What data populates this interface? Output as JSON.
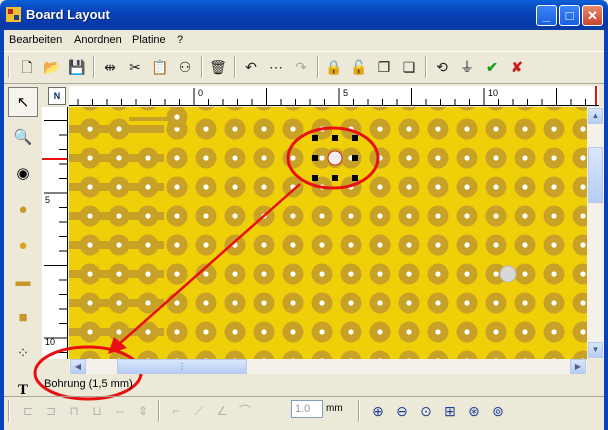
{
  "window": {
    "title": "Board Layout",
    "minimize": "_",
    "maximize": "□",
    "close": "✕"
  },
  "menu": [
    "Bearbeiten",
    "Anordnen",
    "Platine",
    "?"
  ],
  "toolbar": [
    {
      "name": "new-file-icon",
      "glyph": "🗋",
      "enabled": true
    },
    {
      "name": "open-folder-icon",
      "glyph": "📂",
      "enabled": true
    },
    {
      "name": "save-icon",
      "glyph": "💾",
      "enabled": true
    },
    {
      "sep": true
    },
    {
      "name": "mirror-icon",
      "glyph": "⇹",
      "enabled": true
    },
    {
      "name": "cut-icon",
      "glyph": "✂",
      "enabled": true
    },
    {
      "name": "paste-icon",
      "glyph": "📋",
      "enabled": false
    },
    {
      "name": "components-icon",
      "glyph": "⚇",
      "enabled": true
    },
    {
      "sep": true
    },
    {
      "name": "delete-icon",
      "glyph": "🗑",
      "enabled": true
    },
    {
      "sep": true
    },
    {
      "name": "undo-icon",
      "glyph": "↶",
      "enabled": true
    },
    {
      "name": "more-icon",
      "glyph": "⋯",
      "enabled": true
    },
    {
      "name": "redo-icon",
      "glyph": "↷",
      "enabled": false
    },
    {
      "sep": true
    },
    {
      "name": "lock-icon",
      "glyph": "🔒",
      "enabled": false
    },
    {
      "name": "unlock-icon",
      "glyph": "🔓",
      "enabled": false
    },
    {
      "name": "bring-front-icon",
      "glyph": "❐",
      "enabled": true
    },
    {
      "name": "send-back-icon",
      "glyph": "❏",
      "enabled": true
    },
    {
      "sep": true
    },
    {
      "name": "rotate-icon",
      "glyph": "⟲",
      "enabled": true
    },
    {
      "name": "connect-icon",
      "glyph": "⏚",
      "enabled": true
    },
    {
      "name": "ok-check-icon",
      "glyph": "✔",
      "enabled": true,
      "color": "#1e9e1e"
    },
    {
      "name": "cancel-x-icon",
      "glyph": "✘",
      "enabled": true,
      "color": "#c81e1e"
    }
  ],
  "tools": [
    {
      "name": "pointer-tool-icon",
      "glyph": "↖"
    },
    {
      "name": "zoom-tool-icon",
      "glyph": "🔍"
    },
    {
      "name": "pad-tool-icon",
      "glyph": "◉"
    },
    {
      "name": "via-tool-icon",
      "glyph": "●",
      "color": "#c8962a"
    },
    {
      "name": "hole-tool-icon",
      "glyph": "●",
      "color": "#e0a020"
    },
    {
      "name": "smd-pad-tool-icon",
      "glyph": "▬",
      "color": "#c8962a"
    },
    {
      "name": "rect-pad-tool-icon",
      "glyph": "■",
      "color": "#c8962a"
    },
    {
      "name": "footprint-tool-icon",
      "glyph": "⁘",
      "color": "#444"
    },
    {
      "name": "text-tool-icon",
      "glyph": "T"
    }
  ],
  "ruler": {
    "corner_label": "N",
    "h_labels": [
      "0",
      "5",
      "10"
    ],
    "v_labels": [
      "5",
      "10"
    ]
  },
  "status_text": "Bohrung (1,5 mm)",
  "track_width": {
    "value": "1.0",
    "unit": "mm"
  },
  "bottom_toolbar": [
    {
      "name": "align-left-icon",
      "glyph": "⊏",
      "enabled": false
    },
    {
      "name": "align-center-icon",
      "glyph": "⊐",
      "enabled": false
    },
    {
      "name": "align-top-icon",
      "glyph": "⊓",
      "enabled": false
    },
    {
      "name": "align-bottom-icon",
      "glyph": "⊔",
      "enabled": false
    },
    {
      "name": "distribute-h-icon",
      "glyph": "⇔",
      "enabled": false
    },
    {
      "name": "distribute-v-icon",
      "glyph": "⇕",
      "enabled": false
    },
    {
      "sep": true
    },
    {
      "name": "track-straight-icon",
      "glyph": "⌐",
      "enabled": false
    },
    {
      "name": "track-45-icon",
      "glyph": "⟋",
      "enabled": false
    },
    {
      "name": "track-diag-icon",
      "glyph": "∠",
      "enabled": false
    },
    {
      "name": "track-arc-icon",
      "glyph": "⌒",
      "enabled": false
    }
  ],
  "zoom_toolbar": [
    {
      "name": "zoom-in-icon",
      "glyph": "⊕"
    },
    {
      "name": "zoom-out-icon",
      "glyph": "⊖"
    },
    {
      "name": "zoom-fit-icon",
      "glyph": "⊙"
    },
    {
      "name": "zoom-window-icon",
      "glyph": "⊞"
    },
    {
      "name": "zoom-previous-icon",
      "glyph": "⊛"
    },
    {
      "name": "zoom-all-icon",
      "glyph": "⊚"
    }
  ],
  "colors": {
    "board": "#efcf08",
    "pad_ring": "#c8a226",
    "pad_hole": "#ffffff",
    "annotation": "#e81010"
  }
}
